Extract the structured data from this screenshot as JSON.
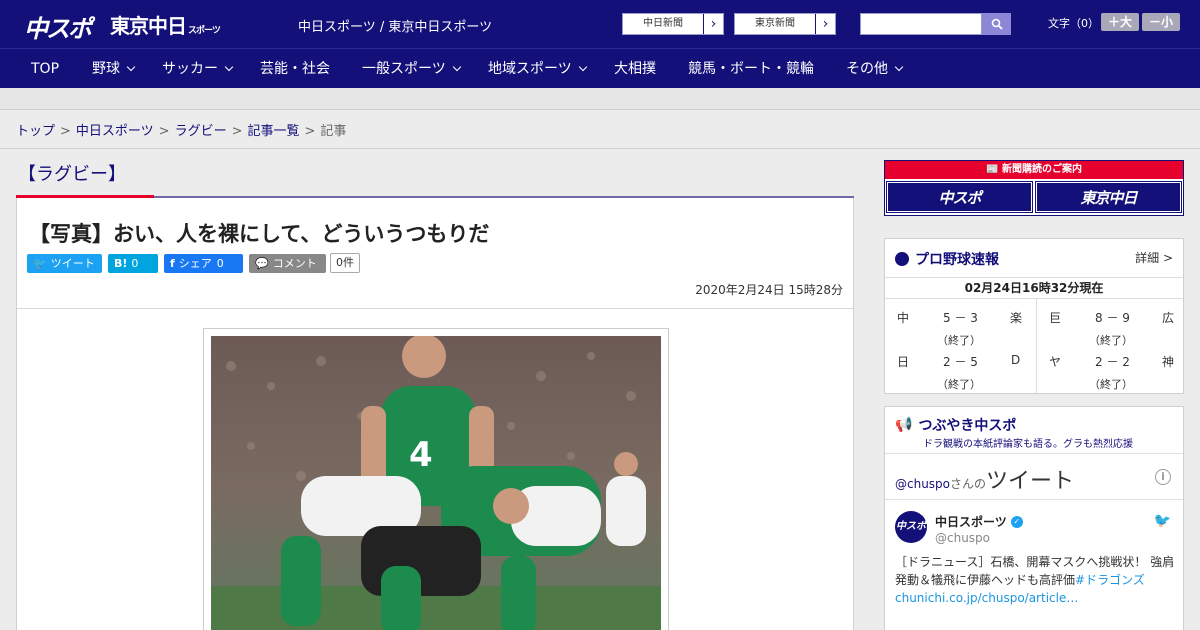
{
  "header": {
    "logo_chuspo": "中スポ",
    "logo_tokyo": "東京中日",
    "logo_tokyo_small": "スポーツ",
    "site_title": "中日スポーツ / 東京中日スポーツ",
    "links": [
      {
        "label": "中日新聞"
      },
      {
        "label": "東京新聞"
      }
    ],
    "search_placeholder": "",
    "font_label": "文字（0）",
    "font_larger": "＋大",
    "font_smaller": "－小"
  },
  "nav": {
    "items": [
      {
        "label": "TOP"
      },
      {
        "label": "野球"
      },
      {
        "label": "サッカー"
      },
      {
        "label": "芸能・社会"
      },
      {
        "label": "一般スポーツ"
      },
      {
        "label": "地域スポーツ"
      },
      {
        "label": "大相撲"
      },
      {
        "label": "競馬・ボート・競輪"
      },
      {
        "label": "その他"
      }
    ]
  },
  "breadcrumb": {
    "items": [
      "トップ",
      "中日スポーツ",
      "ラグビー",
      "記事一覧"
    ],
    "current": "記事",
    "separator": ">"
  },
  "article": {
    "category": "【ラグビー】",
    "headline": "【写真】おい、人を裸にして、どういうつもりだ",
    "share": {
      "twitter": "ツイート",
      "hatena_icon": "B!",
      "hatena_count": "0",
      "facebook": "シェア",
      "facebook_count": "0",
      "comment": "コメント",
      "comment_count": "0件"
    },
    "published": "2020年2月24日 15時28分"
  },
  "sidebar": {
    "subscribe": {
      "title": "新聞購読のご案内",
      "tile1": "中スポ",
      "tile2": "東京中日"
    },
    "baseball": {
      "title": "プロ野球速報",
      "detail": "詳細 >",
      "updated": "02月24日16時32分現在",
      "games": [
        {
          "home": "中",
          "score": "5 － 3",
          "away": "楽",
          "status": "（終了）"
        },
        {
          "home": "巨",
          "score": "8 － 9",
          "away": "広",
          "status": "（終了）"
        },
        {
          "home": "日",
          "score": "2 － 5",
          "away": "D",
          "status": "（終了）"
        },
        {
          "home": "ヤ",
          "score": "2 － 2",
          "away": "神",
          "status": "（終了）"
        }
      ]
    },
    "tweets": {
      "title": "つぶやき中スポ",
      "subtitle": "ドラ観戦の本紙評論家も語る。グラも熱烈応援",
      "handle": "@chuspo",
      "handle_suffix": "さんの",
      "handle_big": "ツイート",
      "avatar": "中スポ",
      "name": "中日スポーツ",
      "user": "@chuspo",
      "text_main": "［ドラニュース］石橋、開幕マスクへ挑戦状！ 強肩発動＆犠飛に伊藤ヘッドも高評価",
      "text_tag": "#ドラゴンズ",
      "text_link": "chunichi.co.jp/chuspo/article…"
    }
  }
}
